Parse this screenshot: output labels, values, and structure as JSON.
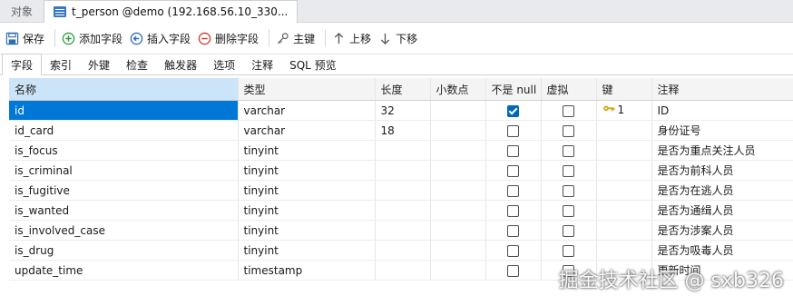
{
  "tabs": {
    "objects": "对象",
    "active": "t_person @demo (192.168.56.10_330..."
  },
  "toolbar": {
    "save": "保存",
    "add_field": "添加字段",
    "insert_field": "插入字段",
    "delete_field": "删除字段",
    "primary_key": "主键",
    "move_up": "上移",
    "move_down": "下移"
  },
  "subtabs": [
    "字段",
    "索引",
    "外键",
    "检查",
    "触发器",
    "选项",
    "注释",
    "SQL 预览"
  ],
  "columns": [
    "名称",
    "类型",
    "长度",
    "小数点",
    "不是 null",
    "虚拟",
    "键",
    "注释"
  ],
  "rows": [
    {
      "name": "id",
      "type": "varchar",
      "length": "32",
      "decimals": "",
      "not_null": true,
      "virtual": false,
      "key": "1",
      "comment": "ID"
    },
    {
      "name": "id_card",
      "type": "varchar",
      "length": "18",
      "decimals": "",
      "not_null": false,
      "virtual": false,
      "key": "",
      "comment": "身份证号"
    },
    {
      "name": "is_focus",
      "type": "tinyint",
      "length": "",
      "decimals": "",
      "not_null": false,
      "virtual": false,
      "key": "",
      "comment": "是否为重点关注人员"
    },
    {
      "name": "is_criminal",
      "type": "tinyint",
      "length": "",
      "decimals": "",
      "not_null": false,
      "virtual": false,
      "key": "",
      "comment": "是否为前科人员"
    },
    {
      "name": "is_fugitive",
      "type": "tinyint",
      "length": "",
      "decimals": "",
      "not_null": false,
      "virtual": false,
      "key": "",
      "comment": "是否为在逃人员"
    },
    {
      "name": "is_wanted",
      "type": "tinyint",
      "length": "",
      "decimals": "",
      "not_null": false,
      "virtual": false,
      "key": "",
      "comment": "是否为通缉人员"
    },
    {
      "name": "is_involved_case",
      "type": "tinyint",
      "length": "",
      "decimals": "",
      "not_null": false,
      "virtual": false,
      "key": "",
      "comment": "是否为涉案人员"
    },
    {
      "name": "is_drug",
      "type": "tinyint",
      "length": "",
      "decimals": "",
      "not_null": false,
      "virtual": false,
      "key": "",
      "comment": "是否为吸毒人员"
    },
    {
      "name": "update_time",
      "type": "timestamp",
      "length": "",
      "decimals": "",
      "not_null": false,
      "virtual": false,
      "key": "",
      "comment": "更新时间"
    }
  ],
  "watermark": "掘金技术社区 @ sxb326",
  "colors": {
    "selection": "#0078d7",
    "header_sorted": "#cce4f7",
    "key_icon": "#d9a21b"
  }
}
